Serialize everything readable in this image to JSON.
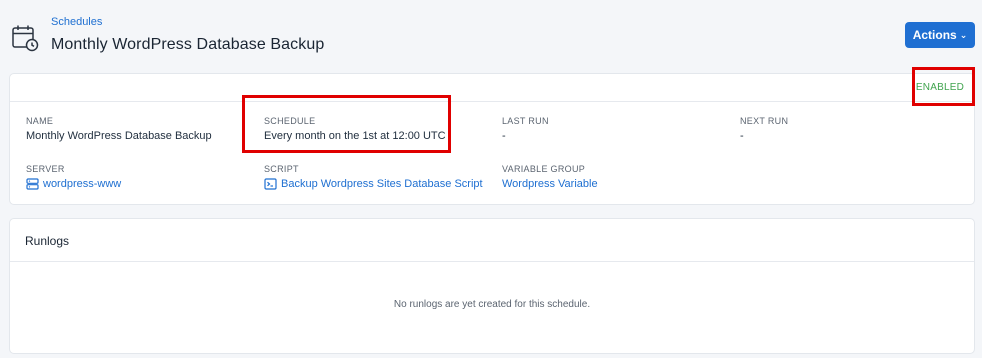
{
  "header": {
    "breadcrumb": "Schedules",
    "title": "Monthly WordPress Database Backup",
    "actions_label": "Actions",
    "page_icon": "calendar-clock-icon"
  },
  "details": {
    "status": "ENABLED",
    "status_color": "#3fa34d",
    "name": {
      "label": "NAME",
      "value": "Monthly WordPress Database Backup"
    },
    "schedule": {
      "label": "SCHEDULE",
      "value": "Every month on the 1st at 12:00 UTC"
    },
    "last_run": {
      "label": "LAST RUN",
      "value": "-"
    },
    "next_run": {
      "label": "NEXT RUN",
      "value": "-"
    },
    "server": {
      "label": "SERVER",
      "value": "wordpress-www",
      "icon": "server-icon"
    },
    "script": {
      "label": "SCRIPT",
      "value": "Backup Wordpress Sites Database Script",
      "icon": "terminal-icon"
    },
    "variable_group": {
      "label": "VARIABLE GROUP",
      "value": "Wordpress Variable"
    }
  },
  "runlogs": {
    "title": "Runlogs",
    "empty_message": "No runlogs are yet created for this schedule."
  },
  "colors": {
    "accent": "#1f6fd2",
    "link": "#1e6fd1",
    "highlight": "#e00000",
    "background": "#f4f6f9"
  }
}
